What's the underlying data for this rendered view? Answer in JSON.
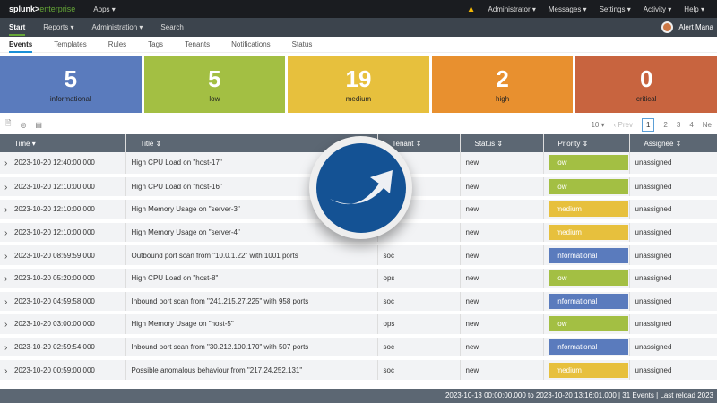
{
  "topbar": {
    "logo": "splunk>",
    "logo_suffix": "enterprise",
    "apps": "Apps ▾",
    "right": [
      "Administrator ▾",
      "Messages ▾",
      "Settings ▾",
      "Activity ▾",
      "Help ▾"
    ]
  },
  "nav": {
    "items": [
      "Start",
      "Reports ▾",
      "Administration ▾",
      "Search"
    ],
    "app_title": "Alert Mana"
  },
  "tabs": [
    "Events",
    "Templates",
    "Rules",
    "Tags",
    "Tenants",
    "Notifications",
    "Status"
  ],
  "tiles": [
    {
      "count": "5",
      "label": "informational",
      "color": "#5a7bbd"
    },
    {
      "count": "5",
      "label": "low",
      "color": "#a3bf43"
    },
    {
      "count": "19",
      "label": "medium",
      "color": "#e7c03d"
    },
    {
      "count": "2",
      "label": "high",
      "color": "#e8902f"
    },
    {
      "count": "0",
      "label": "critical",
      "color": "#c8643f"
    }
  ],
  "pager": {
    "size": "10 ▾",
    "prev": "‹ Prev",
    "pages": [
      "1",
      "2",
      "3",
      "4"
    ],
    "next": "Ne"
  },
  "columns": [
    "Time ▾",
    "Title ⇕",
    "Tenant ⇕",
    "Status ⇕",
    "Priority ⇕",
    "Assignee ⇕"
  ],
  "priority_colors": {
    "low": "#a3bf43",
    "medium": "#e7c03d",
    "informational": "#5a7bbd"
  },
  "rows": [
    [
      "2023-10-20 12:40:00.000",
      "High CPU Load on \"host-17\"",
      "",
      "new",
      "low",
      "unassigned"
    ],
    [
      "2023-10-20 12:10:00.000",
      "High CPU Load on \"host-16\"",
      "",
      "new",
      "low",
      "unassigned"
    ],
    [
      "2023-10-20 12:10:00.000",
      "High Memory Usage on \"server-3\"",
      "",
      "new",
      "medium",
      "unassigned"
    ],
    [
      "2023-10-20 12:10:00.000",
      "High Memory Usage on \"server-4\"",
      "",
      "new",
      "medium",
      "unassigned"
    ],
    [
      "2023-10-20 08:59:59.000",
      "Outbound port scan from \"10.0.1.22\" with 1001 ports",
      "soc",
      "new",
      "informational",
      "unassigned"
    ],
    [
      "2023-10-20 05:20:00.000",
      "High CPU Load on \"host-8\"",
      "ops",
      "new",
      "low",
      "unassigned"
    ],
    [
      "2023-10-20 04:59:58.000",
      "Inbound port scan from \"241.215.27.225\" with 958 ports",
      "soc",
      "new",
      "informational",
      "unassigned"
    ],
    [
      "2023-10-20 03:00:00.000",
      "High Memory Usage on \"host-5\"",
      "ops",
      "new",
      "low",
      "unassigned"
    ],
    [
      "2023-10-20 02:59:54.000",
      "Inbound port scan from \"30.212.100.170\" with 507 ports",
      "soc",
      "new",
      "informational",
      "unassigned"
    ],
    [
      "2023-10-20 00:59:00.000",
      "Possible anomalous behaviour from \"217.24.252.131\"",
      "soc",
      "new",
      "medium",
      "unassigned"
    ]
  ],
  "footer": "2023-10-13 00:00:00.000 to 2023-10-20 13:16:01.000  |  31 Events  |  Last reload 2023"
}
